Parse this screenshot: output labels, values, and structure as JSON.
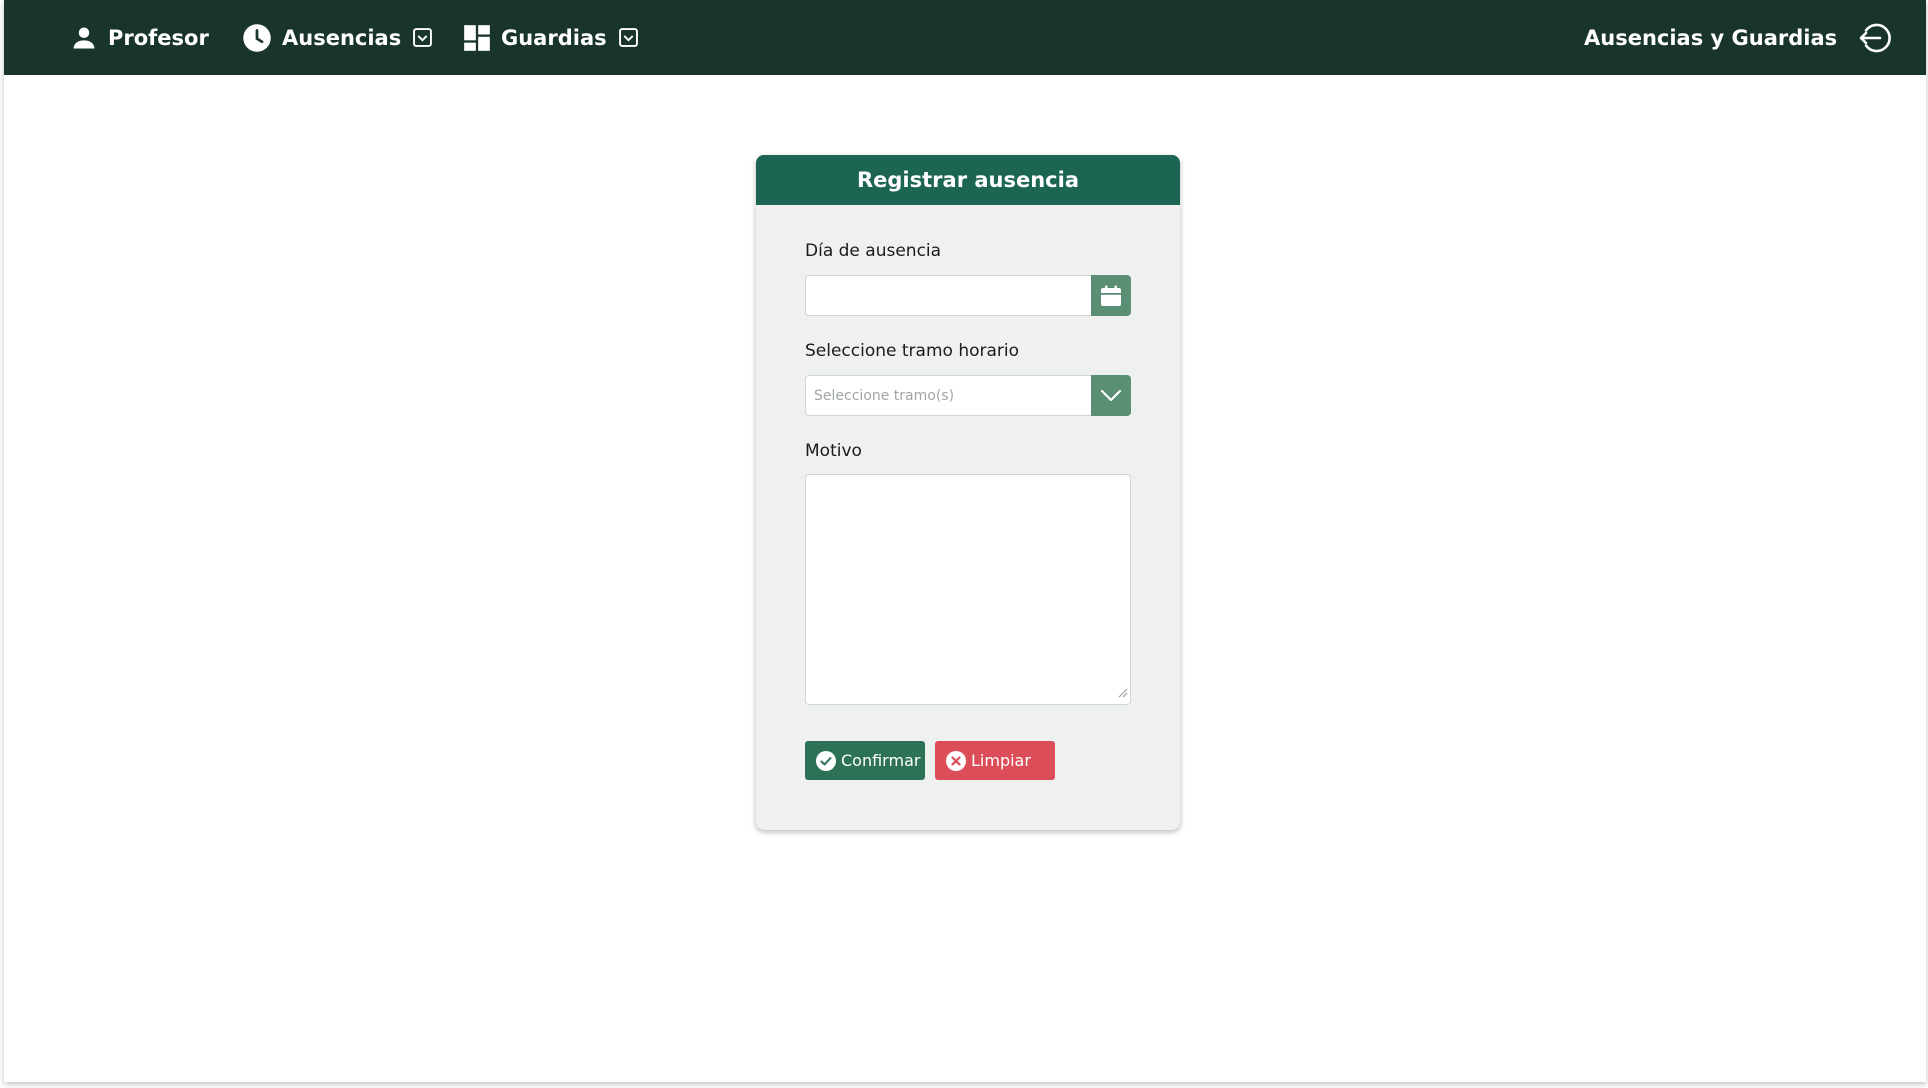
{
  "navbar": {
    "profesor_label": "Profesor",
    "ausencias_label": "Ausencias",
    "guardias_label": "Guardias",
    "brand_label": "Ausencias y Guardias"
  },
  "form": {
    "title": "Registrar ausencia",
    "date_label": "Día de ausencia",
    "date_value": "",
    "tramo_label": "Seleccione tramo horario",
    "tramo_placeholder": "Seleccione tramo(s)",
    "motivo_label": "Motivo",
    "motivo_value": "",
    "confirm_label": "Confirmar",
    "clear_label": "Limpiar"
  },
  "icons": {
    "profesor": "user-icon",
    "ausencias": "clock-icon",
    "ausencias_caret": "chevron-down-box-icon",
    "guardias": "dashboard-icon",
    "guardias_caret": "chevron-down-box-icon",
    "logout": "logout-icon",
    "date_picker": "calendar-icon",
    "tramo_dropdown": "chevron-down-icon",
    "confirm": "check-circle-icon",
    "clear": "x-circle-icon"
  },
  "colors": {
    "navbar_bg": "#19352a",
    "card_header_bg": "#1b6552",
    "card_bg": "#eef1f0",
    "addon_bg": "#5a8f76",
    "confirm_bg": "#2d7256",
    "clear_bg": "#db4e59"
  }
}
